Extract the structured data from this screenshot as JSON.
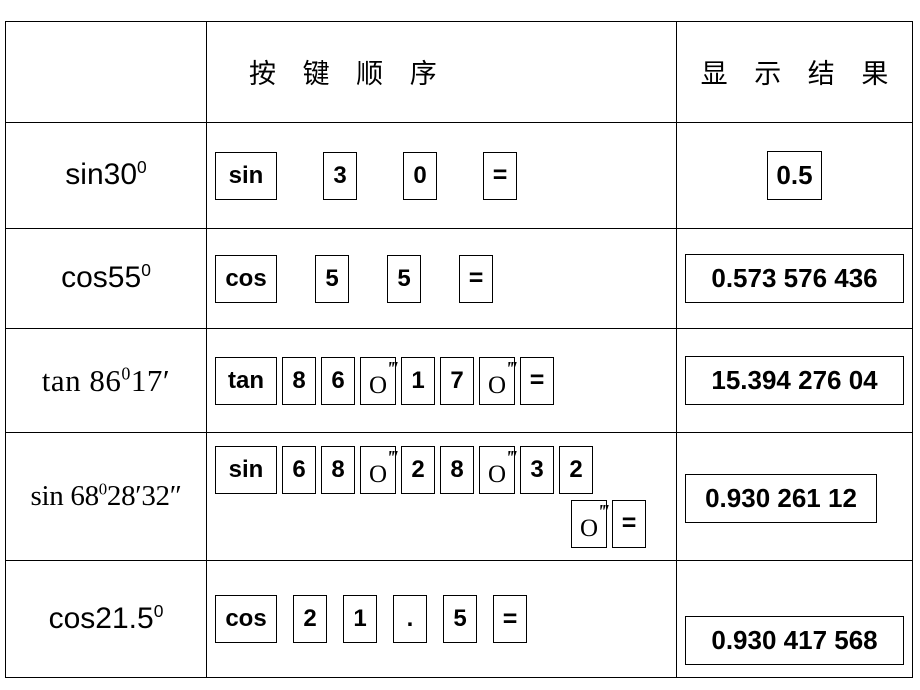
{
  "table": {
    "header": {
      "col1": "",
      "col2": "按 键 顺 序",
      "col3": "显 示 结 果"
    },
    "rows": [
      {
        "expr_style": "sans",
        "expr_main": "sin30",
        "expr_sup": "0",
        "keys": [
          "sin",
          "3",
          "0",
          "="
        ],
        "result": "0.5"
      },
      {
        "expr_style": "sans",
        "expr_main": "cos55",
        "expr_sup": "0",
        "keys": [
          "cos",
          "5",
          "5",
          "="
        ],
        "result": "0.573 576 436"
      },
      {
        "expr_style": "serif",
        "expr_main": "tan 86",
        "expr_sup": "0",
        "expr_tail": "17′",
        "keys": [
          "tan",
          "8",
          "6",
          "o‴",
          "1",
          "7",
          "o‴",
          "="
        ],
        "result": "15.394 276  04"
      },
      {
        "expr_style": "serif",
        "expr_main": "sin 68",
        "expr_sup": "0",
        "expr_tail": "28′32″",
        "keys": [
          "sin",
          "6",
          "8",
          "o‴",
          "2",
          "8",
          "o‴",
          "3",
          "2"
        ],
        "keys_line2": [
          "o‴",
          "="
        ],
        "result": "0.930 261 12"
      },
      {
        "expr_style": "sans",
        "expr_main": "cos21.5",
        "expr_sup": "0",
        "keys": [
          "cos",
          "2",
          "1",
          ".",
          "5",
          "="
        ],
        "result": "0.930 417 568"
      }
    ]
  },
  "key_glyphs": {
    "dms_base": "O",
    "dms_prime": "‴"
  },
  "colors": {
    "border": "#000000",
    "background": "#ffffff",
    "text": "#000000"
  }
}
